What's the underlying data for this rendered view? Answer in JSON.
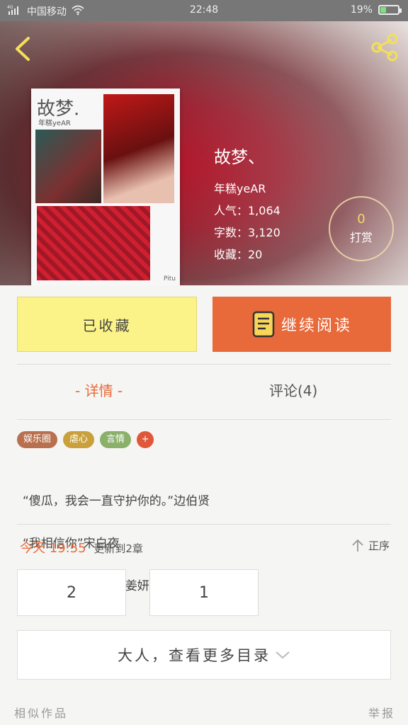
{
  "status_bar": {
    "network": "4G",
    "carrier": "中国移动",
    "time": "22:48",
    "battery": "19%"
  },
  "header": {
    "back_icon": "chevron-left-icon",
    "share_icon": "share-icon"
  },
  "book": {
    "cover_title": "故梦.",
    "cover_author": "年糕yeAR",
    "cover_signature": "Pitu",
    "title": "故梦、",
    "author": "年糕yeAR",
    "popularity": "人气：1,064",
    "word_count": "字数：3,120",
    "favorites": "收藏：20"
  },
  "reward": {
    "count": "0",
    "label": "打赏"
  },
  "actions": {
    "favorite_label": "已收藏",
    "read_label": "继续阅读"
  },
  "tabs": {
    "detail": "- 详情 -",
    "comments": "评论(4)"
  },
  "tags": [
    {
      "label": "娱乐圈",
      "color": "#b8704e"
    },
    {
      "label": "虐心",
      "color": "#c9a03c"
    },
    {
      "label": "言情",
      "color": "#8ab06a"
    },
    {
      "label": "+",
      "color": "#e0573a"
    }
  ],
  "summary": {
    "line1": "“傻瓜，我会一直守护你的。”边伯贤",
    "line2": "“我相信你”宋白夜",
    "line3": "“边伯贤，是她推了姜妍你没有看到吗！”…"
  },
  "update": {
    "time": "今天 19:55",
    "text": "更新到2章"
  },
  "sort": {
    "label": "正序"
  },
  "chapters": [
    "2",
    "1"
  ],
  "more_catalog": "大人，查看更多目录",
  "footer": {
    "similar": "相似作品",
    "report": "举报"
  },
  "colors": {
    "accent": "#e8693a",
    "favorite_bg": "#fbf387"
  }
}
